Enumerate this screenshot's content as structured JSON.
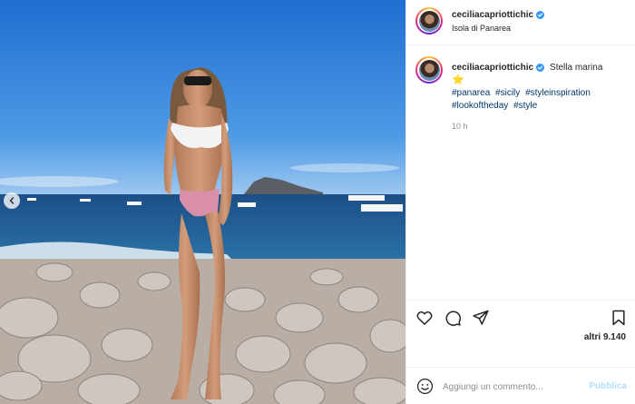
{
  "post": {
    "author": {
      "username": "ceciliacapriottichic",
      "verified": true,
      "location": "Isola di Panarea"
    },
    "caption": {
      "username": "ceciliacapriottichic",
      "text": "Stella marina",
      "emoji": "⭐",
      "hashtags": [
        "#panarea",
        "#sicily",
        "#styleinspiration",
        "#lookoftheday",
        "#style"
      ]
    },
    "timestamp": "10 h",
    "likes": "altri 9.140",
    "comment": {
      "placeholder": "Aggiungi un commento...",
      "submit_label": "Pubblica"
    }
  },
  "icons": {
    "prev": "chevron-left-icon",
    "like": "heart-icon",
    "comment": "comment-icon",
    "share": "paper-plane-icon",
    "save": "bookmark-icon",
    "emoji": "emoji-smile-icon",
    "verified": "verified-badge-icon"
  },
  "colors": {
    "hashtag": "#00376b",
    "verified": "#3897f0",
    "muted": "#8e8e8e",
    "publish_disabled": "#b2dffc"
  }
}
